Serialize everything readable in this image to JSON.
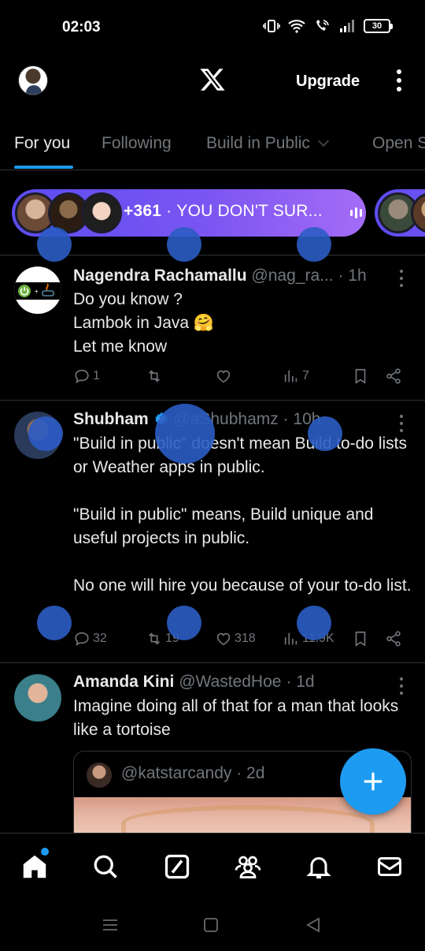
{
  "status_bar": {
    "time": "02:03",
    "battery": "30"
  },
  "header": {
    "logo": "x-logo-icon",
    "upgrade_label": "Upgrade"
  },
  "tabs": [
    {
      "label": "For you",
      "active": true
    },
    {
      "label": "Following"
    },
    {
      "label": "Build in Public"
    },
    {
      "label": "Open S"
    }
  ],
  "space": {
    "count": "+361",
    "separator": "·",
    "title": "YOU DON'T SUR..."
  },
  "tweets": [
    {
      "name": "Nagendra Rachamallu",
      "handle": "@nag_ra...",
      "time": "· 1h",
      "body": "Do you know ?\nLambok in Java 🤗\nLet me know",
      "replies": "1",
      "reposts": "",
      "likes": "",
      "views": "7"
    },
    {
      "name": "Shubham",
      "handle": "@aShubhamz",
      "time": "· 10h",
      "verified": true,
      "body": "\"Build in public\" doesn't mean Build to-do lists or Weather apps in public.\n\n\"Build in public\" means, Build unique and useful projects in public.\n\nNo one will hire you because of your to-do list.",
      "replies": "32",
      "reposts": "19",
      "likes": "318",
      "views": "11.9K"
    },
    {
      "name": "Amanda Kini",
      "handle": "@WastedHoe",
      "time": "· 1d",
      "body": "Imagine doing all of that for a man that looks like a tortoise",
      "quote": {
        "handle": "@katstarcandy",
        "time": "· 2d"
      }
    }
  ],
  "bottom_nav": [
    "home-icon",
    "search-icon",
    "grok-icon",
    "communities-icon",
    "notifications-icon",
    "messages-icon"
  ],
  "colors": {
    "accent": "#1d9bf0",
    "background": "#000000",
    "muted": "#71767b",
    "text": "#e7e9ea"
  }
}
